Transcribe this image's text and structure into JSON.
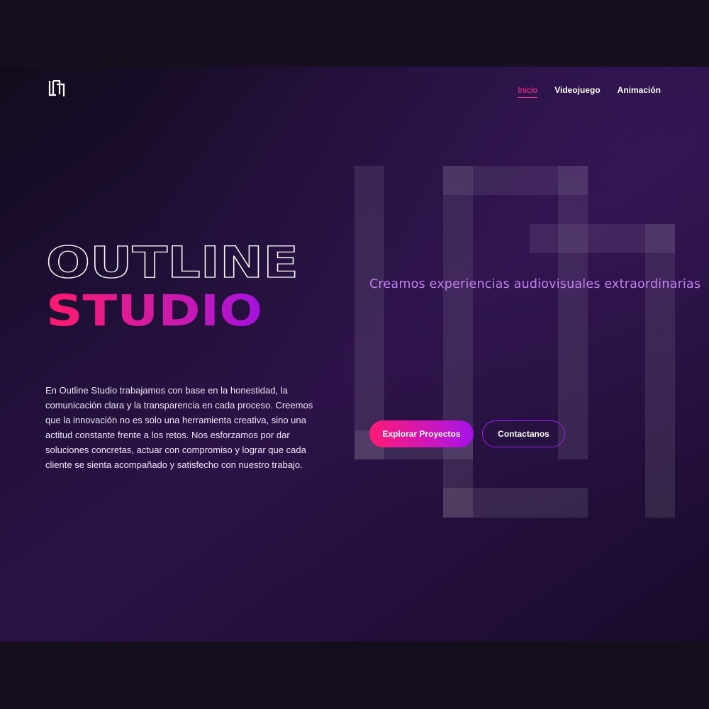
{
  "brand": {
    "logo_icon": "outline-studio-monogram-icon"
  },
  "nav": {
    "items": [
      {
        "label": "Inicio",
        "active": true
      },
      {
        "label": "Videojuego",
        "active": false
      },
      {
        "label": "Animación",
        "active": false
      }
    ]
  },
  "hero": {
    "title_line1": "OUTLINE",
    "title_line2": "STUDIO",
    "tagline": "Creamos experiencias audiovisuales extraordinarias",
    "description": "En Outline Studio trabajamos con base en la honestidad, la comunicación clara y la transparencia en cada proceso. Creemos que la innovación no es solo una herramienta creativa, sino una actitud constante frente a los retos. Nos esforzamos por dar soluciones concretas, actuar con compromiso y lograr que cada cliente se sienta acompañado y satisfecho con nuestro trabajo.",
    "primary_button": "Explorar Proyectos",
    "secondary_button": "Contactanos"
  },
  "colors": {
    "accent_pink": "#ff1a73",
    "accent_purple": "#a312e6",
    "tagline": "#c47ff0",
    "background": "#24103c"
  }
}
